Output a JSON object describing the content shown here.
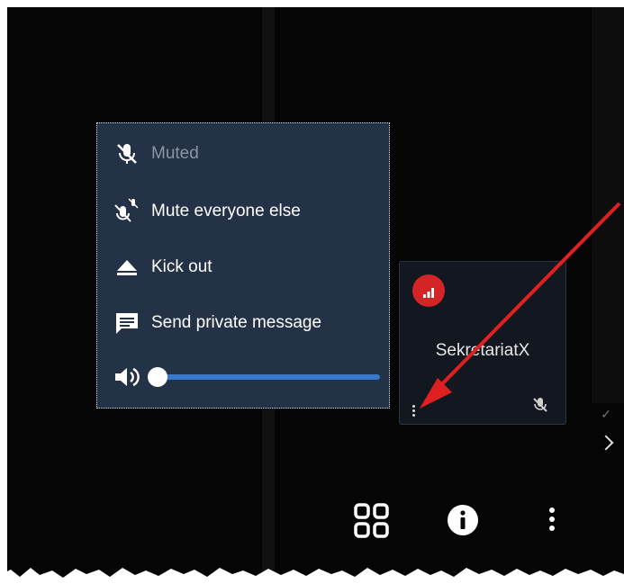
{
  "menu": {
    "items": [
      {
        "label": "Muted",
        "icon": "microphone-muted-icon",
        "disabled": true
      },
      {
        "label": "Mute everyone else",
        "icon": "mute-everyone-icon",
        "disabled": false
      },
      {
        "label": "Kick out",
        "icon": "eject-icon",
        "disabled": false
      },
      {
        "label": "Send private message",
        "icon": "message-icon",
        "disabled": false
      }
    ],
    "volume": {
      "icon": "speaker-icon",
      "level": 0.0
    }
  },
  "participant": {
    "name": "SekretariatX",
    "badge_icon": "signal-bars-icon",
    "badge_color": "#d32525",
    "options_icon": "vertical-dots-icon",
    "mic_icon": "microphone-muted-icon"
  },
  "toolbar": {
    "buttons": [
      {
        "icon": "grid-view-icon"
      },
      {
        "icon": "info-icon"
      },
      {
        "icon": "more-options-icon"
      }
    ]
  },
  "annotation": {
    "arrow_color": "#e02020"
  },
  "colors": {
    "menu_bg": "#233247",
    "slider": "#3a78c8",
    "background": "#050505"
  }
}
